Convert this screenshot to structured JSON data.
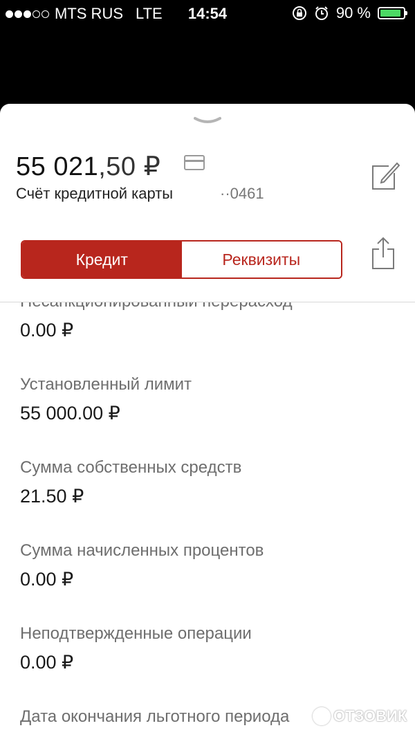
{
  "status_bar": {
    "carrier": "MTS RUS",
    "network": "LTE",
    "time": "14:54",
    "battery": "90 %",
    "battery_level": 0.9,
    "signal_bars": 3,
    "icons": [
      "rotation-lock-icon",
      "alarm-icon",
      "battery-icon"
    ]
  },
  "colors": {
    "accent": "#b8261d",
    "battery_fill": "#4cd964"
  },
  "account": {
    "balance_int": "55 021",
    "balance_frac": ",50 ₽",
    "name": "Счёт кредитной карты",
    "number": "··0461"
  },
  "tabs": [
    {
      "label": "Кредит",
      "active": true
    },
    {
      "label": "Реквизиты",
      "active": false
    }
  ],
  "details": [
    {
      "label": "Несанкционированный перерасход",
      "value": "0.00 ₽"
    },
    {
      "label": "Установленный лимит",
      "value": "55 000.00 ₽"
    },
    {
      "label": "Сумма собственных средств",
      "value": "21.50 ₽"
    },
    {
      "label": "Сумма начисленных процентов",
      "value": "0.00 ₽"
    },
    {
      "label": "Неподтвержденные операции",
      "value": "0.00 ₽"
    },
    {
      "label": "Дата окончания льготного периода",
      "value": ""
    }
  ],
  "watermark": "ОТЗОВИК"
}
